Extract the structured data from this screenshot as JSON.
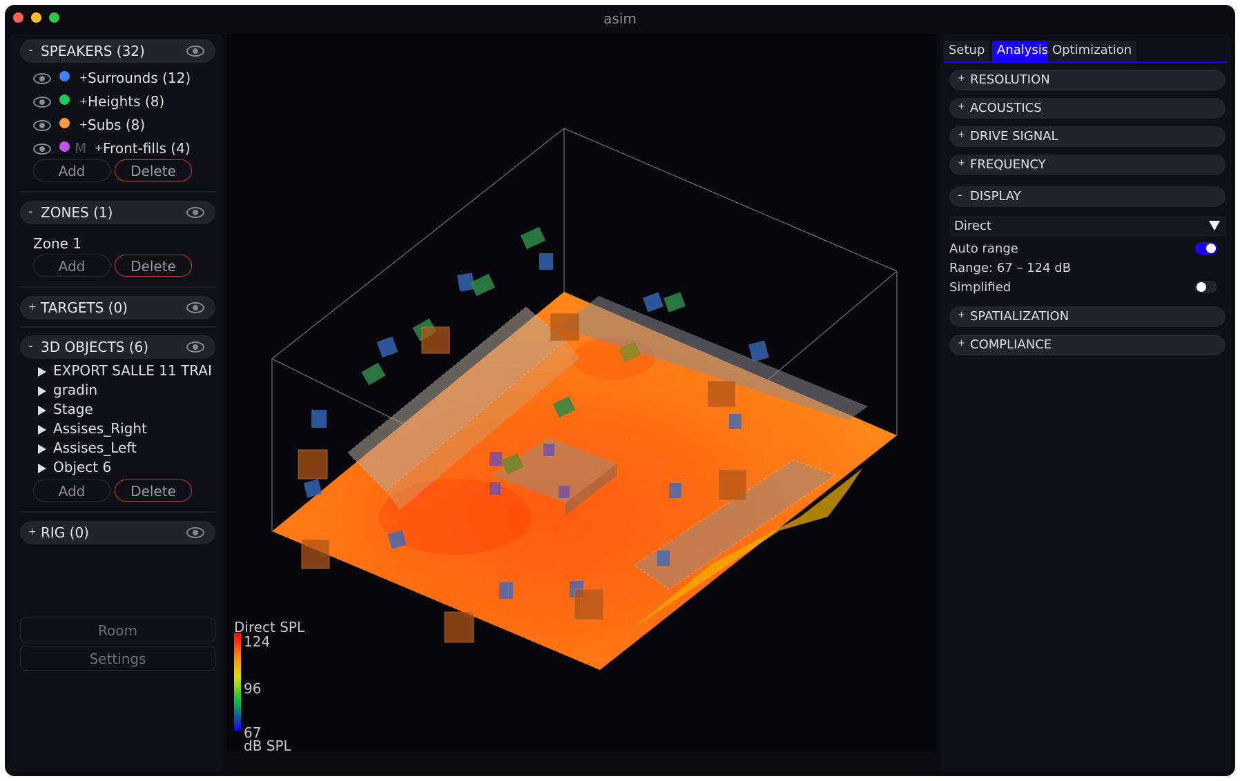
{
  "app": {
    "title": "asim"
  },
  "speakers": {
    "header": "SPEAKERS (32)",
    "items": [
      {
        "label": "Surrounds (12)",
        "color": "#3b82f6"
      },
      {
        "label": "Heights (8)",
        "color": "#22c55e"
      },
      {
        "label": "Subs (8)",
        "color": "#f59e3b"
      },
      {
        "label": "Front-fills (4)",
        "color": "#c154e6",
        "flag": "M"
      }
    ],
    "add_label": "Add",
    "delete_label": "Delete"
  },
  "zones": {
    "header": "ZONES (1)",
    "items": [
      "Zone 1"
    ],
    "add_label": "Add",
    "delete_label": "Delete"
  },
  "targets": {
    "header": "TARGETS (0)"
  },
  "objects": {
    "header": "3D OBJECTS (6)",
    "items": [
      "EXPORT SALLE 11 TRAI",
      "gradin",
      "Stage",
      "Assises_Right",
      "Assises_Left",
      "Object 6"
    ],
    "add_label": "Add",
    "delete_label": "Delete"
  },
  "rig": {
    "header": "RIG (0)"
  },
  "bottom": {
    "room_label": "Room",
    "settings_label": "Settings"
  },
  "tabs": [
    "Setup",
    "Analysis",
    "Optimization"
  ],
  "active_tab": "Analysis",
  "accordion_top": [
    "RESOLUTION",
    "ACOUSTICS",
    "DRIVE SIGNAL",
    "FREQUENCY"
  ],
  "display": {
    "header": "DISPLAY",
    "mode": "Direct",
    "auto_range_label": "Auto range",
    "auto_range_on": true,
    "range_label": "Range: 67 – 124 dB",
    "simplified_label": "Simplified",
    "simplified_on": false
  },
  "accordion_bottom": [
    "SPATIALIZATION",
    "COMPLIANCE"
  ],
  "legend": {
    "title": "Direct SPL",
    "max": "124",
    "mid": "96",
    "min": "67",
    "unit": "dB SPL"
  },
  "colors": {
    "accent": "#1a00ff",
    "delete_border": "#c13a3a",
    "floor": "#ff7a12",
    "surround": "#3b6bbf",
    "height": "#2f8a4a",
    "sub": "#b0561a"
  }
}
